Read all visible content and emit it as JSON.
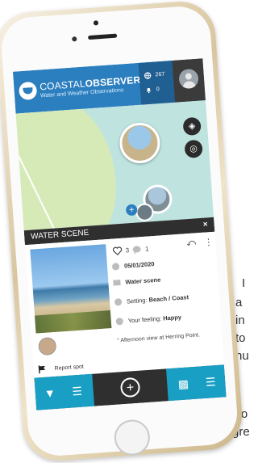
{
  "app": {
    "brand_light": "COASTAL",
    "brand_bold": "OBSERVER",
    "tagline": "Water and Weather Observations",
    "stat_observations": "267",
    "stat_alerts": "0"
  },
  "panel": {
    "title": "WATER SCENE",
    "close": "×"
  },
  "observation": {
    "likes": "3",
    "comments": "1",
    "date": "05/01/2020",
    "category": "Water scene",
    "setting_label": "Setting: ",
    "setting_value": "Beach / Coast",
    "feeling_label": "Your feeling: ",
    "feeling_value": "Happy",
    "caption": "Afternoon view at Herring Point.",
    "report": "Report spot"
  },
  "background_text": {
    "line1": "I",
    "line2": "a",
    "line3": "in",
    "line4": "to",
    "line5": "hu",
    "line6": "Co",
    "line7": "gre"
  },
  "colors": {
    "accent": "#2c7fbf",
    "teal": "#1a9fc4",
    "dark": "#2f2f2f"
  }
}
